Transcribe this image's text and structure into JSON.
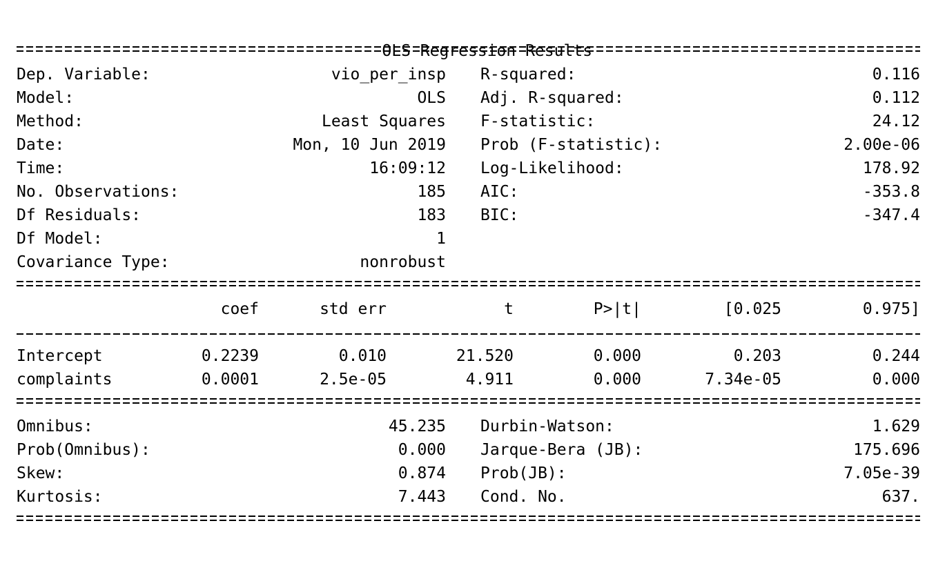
{
  "title": "OLS Regression Results",
  "summary": {
    "left": [
      {
        "label": "Dep. Variable:",
        "value": "vio_per_insp"
      },
      {
        "label": "Model:",
        "value": "OLS"
      },
      {
        "label": "Method:",
        "value": "Least Squares"
      },
      {
        "label": "Date:",
        "value": "Mon, 10 Jun 2019"
      },
      {
        "label": "Time:",
        "value": "16:09:12"
      },
      {
        "label": "No. Observations:",
        "value": "185"
      },
      {
        "label": "Df Residuals:",
        "value": "183"
      },
      {
        "label": "Df Model:",
        "value": "1"
      },
      {
        "label": "Covariance Type:",
        "value": "nonrobust"
      }
    ],
    "right": [
      {
        "label": "R-squared:",
        "value": "0.116"
      },
      {
        "label": "Adj. R-squared:",
        "value": "0.112"
      },
      {
        "label": "F-statistic:",
        "value": "24.12"
      },
      {
        "label": "Prob (F-statistic):",
        "value": "2.00e-06"
      },
      {
        "label": "Log-Likelihood:",
        "value": "178.92"
      },
      {
        "label": "AIC:",
        "value": "-353.8"
      },
      {
        "label": "BIC:",
        "value": "-347.4"
      }
    ]
  },
  "coef_table": {
    "headers": [
      "coef",
      "std err",
      "t",
      "P>|t|",
      "[0.025",
      "0.975]"
    ],
    "rows": [
      {
        "name": "Intercept",
        "values": [
          "0.2239",
          "0.010",
          "21.520",
          "0.000",
          "0.203",
          "0.244"
        ]
      },
      {
        "name": "complaints",
        "values": [
          "0.0001",
          "2.5e-05",
          "4.911",
          "0.000",
          "7.34e-05",
          "0.000"
        ]
      }
    ]
  },
  "diagnostics": {
    "left": [
      {
        "label": "Omnibus:",
        "value": "45.235"
      },
      {
        "label": "Prob(Omnibus):",
        "value": "0.000"
      },
      {
        "label": "Skew:",
        "value": "0.874"
      },
      {
        "label": "Kurtosis:",
        "value": "7.443"
      }
    ],
    "right": [
      {
        "label": "Durbin-Watson:",
        "value": "1.629"
      },
      {
        "label": "Jarque-Bera (JB):",
        "value": "175.696"
      },
      {
        "label": "Prob(JB):",
        "value": "7.05e-39"
      },
      {
        "label": "Cond. No.",
        "value": "637."
      }
    ]
  }
}
